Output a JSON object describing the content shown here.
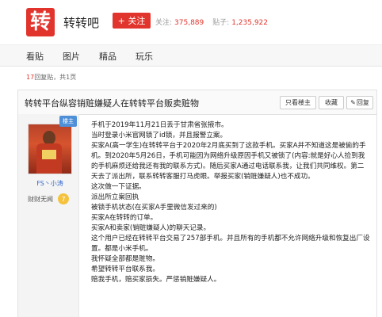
{
  "header": {
    "logo_char": "转",
    "forum_name": "转转吧",
    "follow_label": "+ 关注",
    "followers_label": "关注:",
    "followers_value": "375,889",
    "posts_label": "贴子:",
    "posts_value": "1,235,922"
  },
  "nav": {
    "items": [
      "看贴",
      "图片",
      "精品",
      "玩乐"
    ]
  },
  "reply_count": {
    "count": "17",
    "text": "回复贴，共1页"
  },
  "thread": {
    "title": "转转平台纵容销赃嫌疑人在转转平台贩卖赃物",
    "only_author_label": "只看楼主",
    "collect_label": "收藏",
    "reply_label": "回复"
  },
  "post": {
    "louzhu_label": "楼主",
    "author_name": "FS丶小涛",
    "badge_text": "财财无闻",
    "badge_level": "7",
    "lines": [
      "手机于2019年11月21日丢于甘肃省张掖市。",
      "当时登录小米官网锁了id锁，并且报警立案。",
      "买家A(高一学生)在转转平台于2020年2月底买到了这款手机。买家A并不知道这是被偷的手机。到2020年5月26日，手机可能因为网络升级原因手机又被锁了(内容:就是好心人捡到我的手机麻烦还给我还有我的联系方式)。随后买家A通过电话联系我，让我们共同维权。第二天去了派出所，联系转转客服打马虎眼。举报买家(销赃嫌疑人)也不成功。",
      "这次做一下证据。",
      "派出所立案回执",
      "被锁手机状态(在买家A手里微信发过来的)",
      "买家A在转转的订单。",
      "买家A和卖家(销赃嫌疑人)的聊天记录。",
      "这个用户已经在转转平台交易了257部手机。并且所有的手机都不允许网络升级和恢复出厂设置。都是小米手机。",
      "我怀疑全部都是赃物。",
      "希望转转平台联系我。",
      "赔我手机，赔买家损失。严惩销赃嫌疑人。"
    ]
  },
  "colors": {
    "accent": "#e1342c",
    "link": "#3366cc"
  }
}
